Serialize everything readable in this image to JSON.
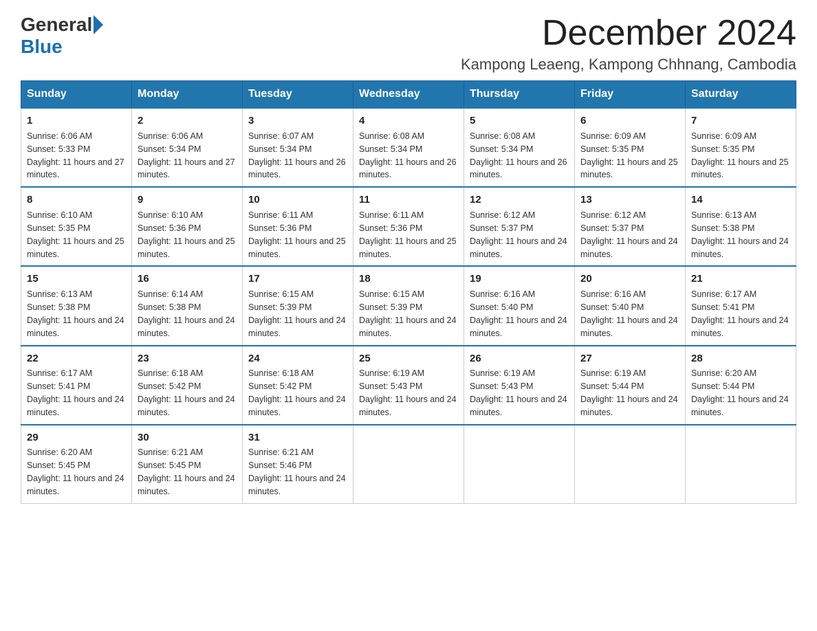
{
  "header": {
    "logo_general": "General",
    "logo_blue": "Blue",
    "month_title": "December 2024",
    "location": "Kampong Leaeng, Kampong Chhnang, Cambodia"
  },
  "days_of_week": [
    "Sunday",
    "Monday",
    "Tuesday",
    "Wednesday",
    "Thursday",
    "Friday",
    "Saturday"
  ],
  "weeks": [
    [
      {
        "day": "1",
        "sunrise": "6:06 AM",
        "sunset": "5:33 PM",
        "daylight": "11 hours and 27 minutes."
      },
      {
        "day": "2",
        "sunrise": "6:06 AM",
        "sunset": "5:34 PM",
        "daylight": "11 hours and 27 minutes."
      },
      {
        "day": "3",
        "sunrise": "6:07 AM",
        "sunset": "5:34 PM",
        "daylight": "11 hours and 26 minutes."
      },
      {
        "day": "4",
        "sunrise": "6:08 AM",
        "sunset": "5:34 PM",
        "daylight": "11 hours and 26 minutes."
      },
      {
        "day": "5",
        "sunrise": "6:08 AM",
        "sunset": "5:34 PM",
        "daylight": "11 hours and 26 minutes."
      },
      {
        "day": "6",
        "sunrise": "6:09 AM",
        "sunset": "5:35 PM",
        "daylight": "11 hours and 25 minutes."
      },
      {
        "day": "7",
        "sunrise": "6:09 AM",
        "sunset": "5:35 PM",
        "daylight": "11 hours and 25 minutes."
      }
    ],
    [
      {
        "day": "8",
        "sunrise": "6:10 AM",
        "sunset": "5:35 PM",
        "daylight": "11 hours and 25 minutes."
      },
      {
        "day": "9",
        "sunrise": "6:10 AM",
        "sunset": "5:36 PM",
        "daylight": "11 hours and 25 minutes."
      },
      {
        "day": "10",
        "sunrise": "6:11 AM",
        "sunset": "5:36 PM",
        "daylight": "11 hours and 25 minutes."
      },
      {
        "day": "11",
        "sunrise": "6:11 AM",
        "sunset": "5:36 PM",
        "daylight": "11 hours and 25 minutes."
      },
      {
        "day": "12",
        "sunrise": "6:12 AM",
        "sunset": "5:37 PM",
        "daylight": "11 hours and 24 minutes."
      },
      {
        "day": "13",
        "sunrise": "6:12 AM",
        "sunset": "5:37 PM",
        "daylight": "11 hours and 24 minutes."
      },
      {
        "day": "14",
        "sunrise": "6:13 AM",
        "sunset": "5:38 PM",
        "daylight": "11 hours and 24 minutes."
      }
    ],
    [
      {
        "day": "15",
        "sunrise": "6:13 AM",
        "sunset": "5:38 PM",
        "daylight": "11 hours and 24 minutes."
      },
      {
        "day": "16",
        "sunrise": "6:14 AM",
        "sunset": "5:38 PM",
        "daylight": "11 hours and 24 minutes."
      },
      {
        "day": "17",
        "sunrise": "6:15 AM",
        "sunset": "5:39 PM",
        "daylight": "11 hours and 24 minutes."
      },
      {
        "day": "18",
        "sunrise": "6:15 AM",
        "sunset": "5:39 PM",
        "daylight": "11 hours and 24 minutes."
      },
      {
        "day": "19",
        "sunrise": "6:16 AM",
        "sunset": "5:40 PM",
        "daylight": "11 hours and 24 minutes."
      },
      {
        "day": "20",
        "sunrise": "6:16 AM",
        "sunset": "5:40 PM",
        "daylight": "11 hours and 24 minutes."
      },
      {
        "day": "21",
        "sunrise": "6:17 AM",
        "sunset": "5:41 PM",
        "daylight": "11 hours and 24 minutes."
      }
    ],
    [
      {
        "day": "22",
        "sunrise": "6:17 AM",
        "sunset": "5:41 PM",
        "daylight": "11 hours and 24 minutes."
      },
      {
        "day": "23",
        "sunrise": "6:18 AM",
        "sunset": "5:42 PM",
        "daylight": "11 hours and 24 minutes."
      },
      {
        "day": "24",
        "sunrise": "6:18 AM",
        "sunset": "5:42 PM",
        "daylight": "11 hours and 24 minutes."
      },
      {
        "day": "25",
        "sunrise": "6:19 AM",
        "sunset": "5:43 PM",
        "daylight": "11 hours and 24 minutes."
      },
      {
        "day": "26",
        "sunrise": "6:19 AM",
        "sunset": "5:43 PM",
        "daylight": "11 hours and 24 minutes."
      },
      {
        "day": "27",
        "sunrise": "6:19 AM",
        "sunset": "5:44 PM",
        "daylight": "11 hours and 24 minutes."
      },
      {
        "day": "28",
        "sunrise": "6:20 AM",
        "sunset": "5:44 PM",
        "daylight": "11 hours and 24 minutes."
      }
    ],
    [
      {
        "day": "29",
        "sunrise": "6:20 AM",
        "sunset": "5:45 PM",
        "daylight": "11 hours and 24 minutes."
      },
      {
        "day": "30",
        "sunrise": "6:21 AM",
        "sunset": "5:45 PM",
        "daylight": "11 hours and 24 minutes."
      },
      {
        "day": "31",
        "sunrise": "6:21 AM",
        "sunset": "5:46 PM",
        "daylight": "11 hours and 24 minutes."
      },
      null,
      null,
      null,
      null
    ]
  ]
}
